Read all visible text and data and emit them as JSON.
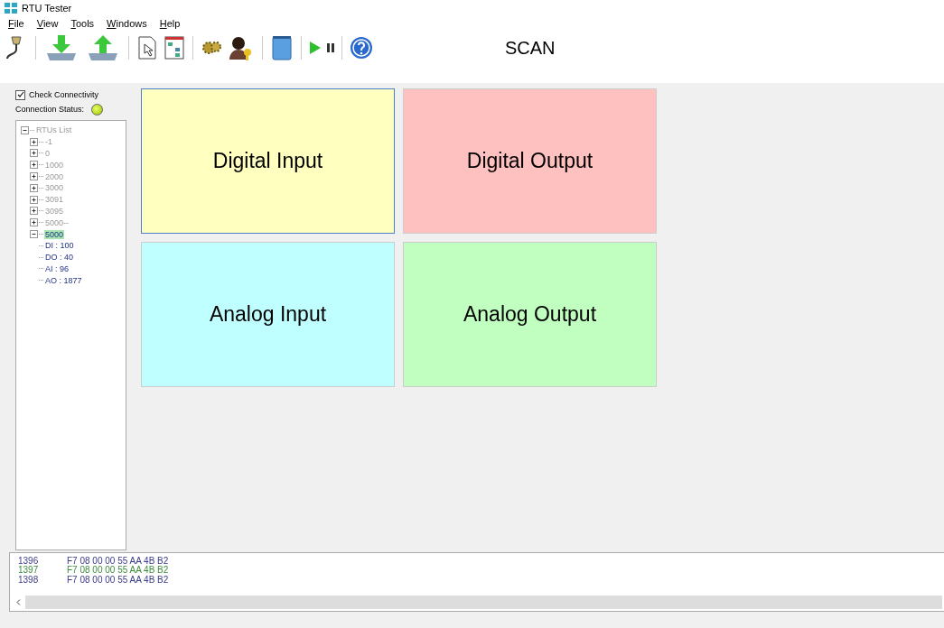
{
  "window": {
    "title": "RTU Tester"
  },
  "menu": [
    "File",
    "View",
    "Tools",
    "Windows",
    "Help"
  ],
  "toolbar": {
    "scan_label": "SCAN"
  },
  "sidebar": {
    "check_connectivity": {
      "label": "Check Connectivity",
      "checked": true
    },
    "connection_status": {
      "label": "Connection Status:",
      "connected": true
    },
    "tree": {
      "label": "RTUs List",
      "expanded": true,
      "selected": false,
      "disabled": true,
      "children": [
        {
          "label": "-1",
          "expanded": false,
          "selected": false,
          "disabled": true
        },
        {
          "label": "0",
          "expanded": false,
          "selected": false,
          "disabled": true
        },
        {
          "label": "1000",
          "expanded": false,
          "selected": false,
          "disabled": true
        },
        {
          "label": "2000",
          "expanded": false,
          "selected": false,
          "disabled": true
        },
        {
          "label": "3000",
          "expanded": false,
          "selected": false,
          "disabled": true
        },
        {
          "label": "3091",
          "expanded": false,
          "selected": false,
          "disabled": true
        },
        {
          "label": "3095",
          "expanded": false,
          "selected": false,
          "disabled": true
        },
        {
          "label": "5000--",
          "expanded": false,
          "selected": false,
          "disabled": true
        },
        {
          "label": "5000",
          "expanded": true,
          "selected": true,
          "disabled": false,
          "children": [
            {
              "label": "DI : 100",
              "selected": false,
              "disabled": false
            },
            {
              "label": "DO : 40",
              "selected": false,
              "disabled": false
            },
            {
              "label": "AI : 96",
              "selected": false,
              "disabled": false
            },
            {
              "label": "AO : 1877",
              "selected": false,
              "disabled": false
            }
          ]
        }
      ]
    }
  },
  "tiles": [
    {
      "label": "Digital Input",
      "color": "#ffffc0",
      "selected": true
    },
    {
      "label": "Digital Output",
      "color": "#ffc0c0",
      "selected": false
    },
    {
      "label": "Analog Input",
      "color": "#c0ffff",
      "selected": false
    },
    {
      "label": "Analog Output",
      "color": "#c0ffc0",
      "selected": false
    }
  ],
  "log": [
    {
      "id": "1396",
      "data": "F7 08 00 00 55 AA 4B B2",
      "color": "#3a3a8c"
    },
    {
      "id": "1397",
      "data": "F7 08 00 00 55 AA 4B B2",
      "color": "#3c8c3c"
    },
    {
      "id": "1398",
      "data": "F7 08 00 00 55 AA 4B B2",
      "color": "#3a3a8c"
    }
  ]
}
